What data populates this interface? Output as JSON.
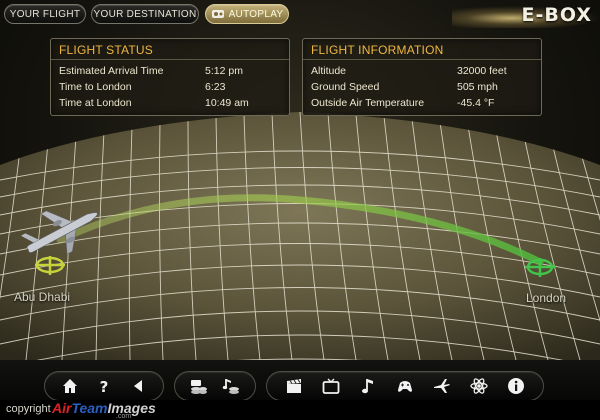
{
  "tabs": [
    {
      "label": "YOUR FLIGHT",
      "active": false
    },
    {
      "label": "YOUR DESTINATION",
      "active": false
    },
    {
      "label": "AUTOPLAY",
      "active": true
    }
  ],
  "logo": "E-BOX",
  "flight_status": {
    "title": "FLIGHT STATUS",
    "rows": [
      {
        "label": "Estimated Arrival Time",
        "value": "5:12 pm"
      },
      {
        "label": "Time to London",
        "value": "6:23"
      },
      {
        "label": "Time at London",
        "value": "10:49 am"
      }
    ]
  },
  "flight_information": {
    "title": "FLIGHT INFORMATION",
    "rows": [
      {
        "label": "Altitude",
        "value": "32000 feet"
      },
      {
        "label": "Ground Speed",
        "value": "505 mph"
      },
      {
        "label": "Outside Air Temperature",
        "value": "-45.4 °F"
      }
    ]
  },
  "map": {
    "origin": "Abu Dhabi",
    "destination": "London"
  },
  "bottom_nav": {
    "group1": [
      "home-icon",
      "help-icon",
      "back-icon"
    ],
    "group2": [
      "movies-icon",
      "music-icon"
    ],
    "group3": [
      "clapperboard-icon",
      "tv-icon",
      "music-note-icon",
      "games-icon",
      "flight-map-icon",
      "science-icon",
      "info-icon"
    ]
  },
  "footer": {
    "copyright": "copyright",
    "logo_air": "Air",
    "logo_team": "Team",
    "logo_images": "Images",
    "logo_sub": ".com"
  },
  "colors": {
    "panel_title": "#f0b640",
    "route_green": "#7fc43b",
    "grid": "#e8e4d2",
    "origin_marker": "#c8d23a",
    "destination_marker": "#43c34a"
  }
}
